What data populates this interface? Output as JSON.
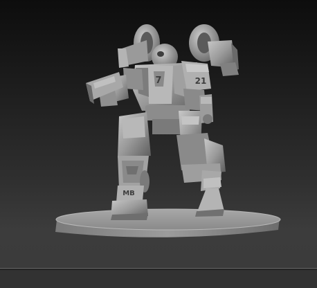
{
  "model": {
    "shoulder_number": "21",
    "leg_marking": "MB",
    "chest_mark": "7"
  },
  "colors": {
    "background_top": "#0d0d0d",
    "background_bottom": "#3c3c3c",
    "material_light": "#b4b4b4",
    "material_mid": "#8e8e8e",
    "material_dark": "#5a5a5a"
  }
}
